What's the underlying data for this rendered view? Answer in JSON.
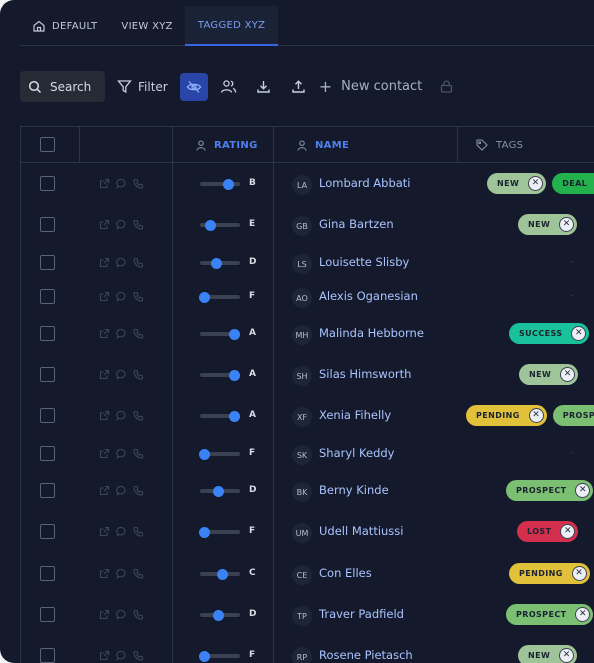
{
  "tabs": [
    {
      "label": "DEFAULT"
    },
    {
      "label": "VIEW XYZ"
    },
    {
      "label": "TAGGED XYZ"
    }
  ],
  "toolbar": {
    "search_label": "Search",
    "filter_label": "Filter",
    "new_contact_label": "New contact"
  },
  "columns": {
    "rating": "RATING",
    "name": "NAME",
    "tags": "TAGS"
  },
  "tag_colors": {
    "NEW": "#9fc49a",
    "DEAL": "#22b14c",
    "SUCCESS": "#1ac29b",
    "PENDING": "#e2c13a",
    "PROSPECT": "#7bbf73",
    "LOST": "#d4304d"
  },
  "rows": [
    {
      "initials": "LA",
      "name": "Lombard Abbati",
      "grade": "B",
      "rating": 0.7,
      "tags": [
        "NEW",
        "DEAL"
      ]
    },
    {
      "initials": "GB",
      "name": "Gina Bartzen",
      "grade": "E",
      "rating": 0.25,
      "tags": [
        "NEW"
      ]
    },
    {
      "initials": "LS",
      "name": "Louisette Slisby",
      "grade": "D",
      "rating": 0.4,
      "tags": []
    },
    {
      "initials": "AO",
      "name": "Alexis Oganesian",
      "grade": "F",
      "rating": 0.1,
      "tags": []
    },
    {
      "initials": "MH",
      "name": "Malinda Hebborne",
      "grade": "A",
      "rating": 0.85,
      "tags": [
        "SUCCESS"
      ]
    },
    {
      "initials": "SH",
      "name": "Silas Himsworth",
      "grade": "A",
      "rating": 0.85,
      "tags": [
        "NEW"
      ]
    },
    {
      "initials": "XF",
      "name": "Xenia Fihelly",
      "grade": "A",
      "rating": 0.85,
      "tags": [
        "PENDING",
        "PROSPECT"
      ]
    },
    {
      "initials": "SK",
      "name": "Sharyl Keddy",
      "grade": "F",
      "rating": 0.1,
      "tags": []
    },
    {
      "initials": "BK",
      "name": "Berny Kinde",
      "grade": "D",
      "rating": 0.45,
      "tags": [
        "PROSPECT"
      ]
    },
    {
      "initials": "UM",
      "name": "Udell Mattiussi",
      "grade": "F",
      "rating": 0.1,
      "tags": [
        "LOST"
      ]
    },
    {
      "initials": "CE",
      "name": "Con Elles",
      "grade": "C",
      "rating": 0.55,
      "tags": [
        "PENDING"
      ]
    },
    {
      "initials": "TP",
      "name": "Traver Padfield",
      "grade": "D",
      "rating": 0.45,
      "tags": [
        "PROSPECT"
      ]
    },
    {
      "initials": "RP",
      "name": "Rosene Pietasch",
      "grade": "F",
      "rating": 0.1,
      "tags": [
        "NEW"
      ]
    }
  ]
}
